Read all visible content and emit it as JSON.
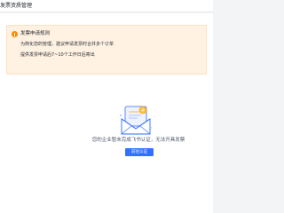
{
  "header": {
    "title": "发票资质管理"
  },
  "notice": {
    "title": "发票申请规则",
    "lines": [
      "为简化您的管理，建议申请发票时合并多个订单",
      "提供发票申请后7~10个工作日后寄出"
    ],
    "icon": "warning-icon"
  },
  "empty_state": {
    "illustration": "document-envelope-illustration",
    "message": "您的企业暂未完成飞书认证，无法开具发票",
    "button_label": "前往认证"
  },
  "colors": {
    "accent": "#3370ff",
    "notice_bg": "#fff2e3",
    "warning": "#ff8800"
  }
}
